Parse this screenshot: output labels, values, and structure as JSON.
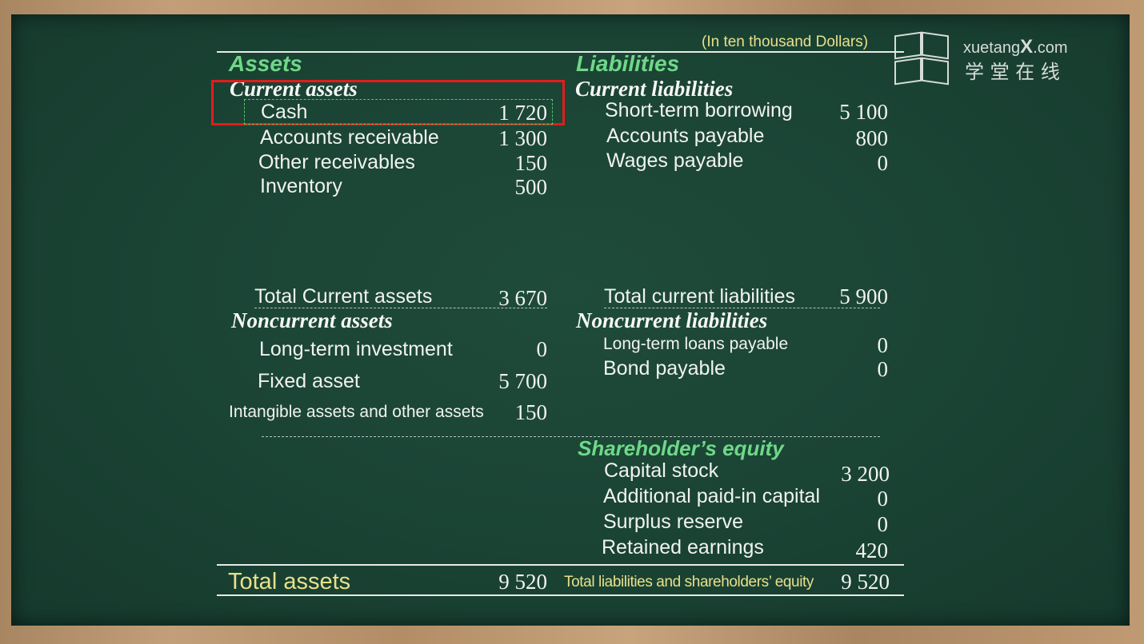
{
  "unit_note": "(In ten thousand Dollars)",
  "brand": {
    "name_prefix": "xuetang",
    "name_x": "X",
    "name_suffix": ".com",
    "chinese": "学 堂 在 线"
  },
  "assets": {
    "heading": "Assets",
    "current": {
      "heading": "Current assets",
      "items": [
        {
          "label": "Cash",
          "value": "1 720"
        },
        {
          "label": "Accounts receivable",
          "value": "1 300"
        },
        {
          "label": "Other receivables",
          "value": "150"
        },
        {
          "label": "Inventory",
          "value": "500"
        }
      ],
      "total_label": "Total Current assets",
      "total_value": "3 670"
    },
    "noncurrent": {
      "heading": "Noncurrent assets",
      "items": [
        {
          "label": "Long-term investment",
          "value": "0"
        },
        {
          "label": "Fixed asset",
          "value": "5 700"
        },
        {
          "label": "Intangible assets and other assets",
          "value": "150"
        }
      ]
    },
    "total_label": "Total assets",
    "total_value": "9 520"
  },
  "liabilities": {
    "heading": "Liabilities",
    "current": {
      "heading": "Current liabilities",
      "items": [
        {
          "label": "Short-term borrowing",
          "value": "5 100"
        },
        {
          "label": "Accounts payable",
          "value": "800"
        },
        {
          "label": "Wages payable",
          "value": "0"
        }
      ],
      "total_label": "Total current liabilities",
      "total_value": "5 900"
    },
    "noncurrent": {
      "heading": "Noncurrent liabilities",
      "items": [
        {
          "label": "Long-term loans payable",
          "value": "0"
        },
        {
          "label": "Bond payable",
          "value": "0"
        }
      ]
    }
  },
  "equity": {
    "heading": "Shareholder’s equity",
    "items": [
      {
        "label": "Capital stock",
        "value": "3 200"
      },
      {
        "label": "Additional paid-in capital",
        "value": "0"
      },
      {
        "label": "Surplus reserve",
        "value": "0"
      },
      {
        "label": "Retained earnings",
        "value": "420"
      }
    ]
  },
  "grand_total": {
    "label": "Total liabilities and shareholders’ equity",
    "value": "9 520"
  },
  "colors": {
    "board": "#1a4334",
    "heading_green": "#6fd888",
    "total_yellow": "#e8e08a",
    "highlight_red": "#e21c1c",
    "highlight_green": "#4fc86a"
  }
}
